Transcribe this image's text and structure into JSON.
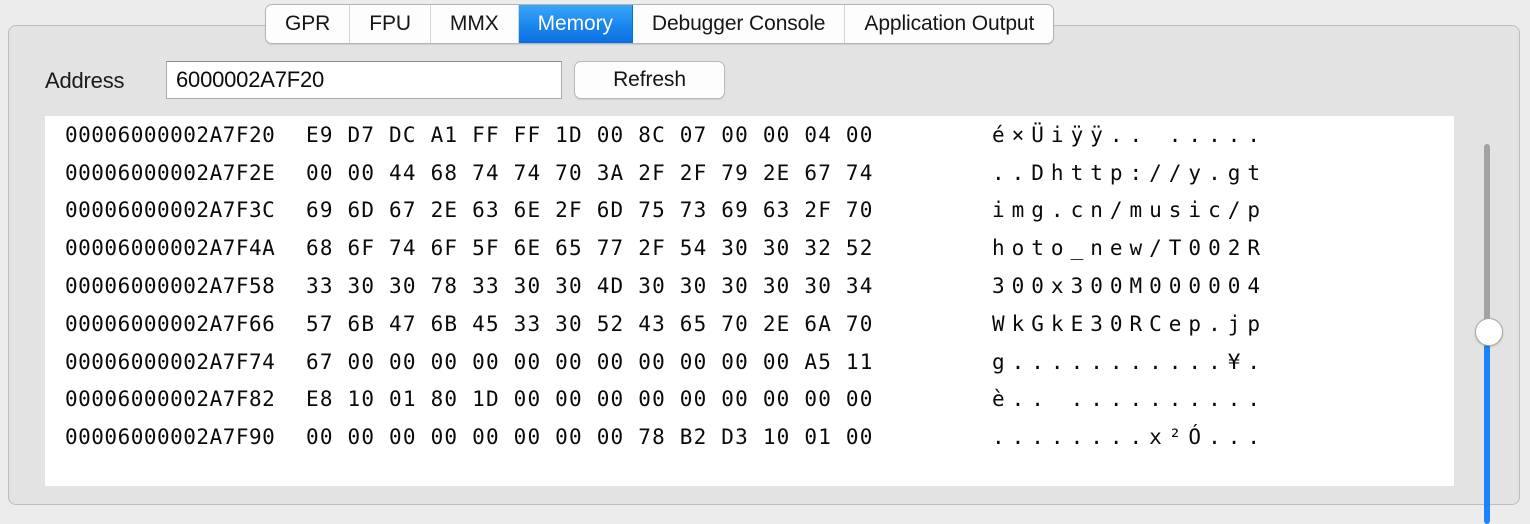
{
  "window": {
    "panel_title": ""
  },
  "tabs": [
    {
      "label": "GPR",
      "active": false
    },
    {
      "label": "FPU",
      "active": false
    },
    {
      "label": "MMX",
      "active": false
    },
    {
      "label": "Memory",
      "active": true
    },
    {
      "label": "Debugger Console",
      "active": false
    },
    {
      "label": "Application Output",
      "active": false
    }
  ],
  "toolbar": {
    "address_label": "Address",
    "address_value": "6000002A7F20",
    "address_placeholder": "",
    "refresh_label": "Refresh"
  },
  "hexview": {
    "bytes_per_row": 14,
    "rows": [
      {
        "address": "00006000002A7F20",
        "bytes": "E9 D7 DC A1 FF FF 1D 00 8C 07 00 00 04 00",
        "ascii": "é×Üiÿÿ.. ....."
      },
      {
        "address": "00006000002A7F2E",
        "bytes": "00 00 44 68 74 74 70 3A 2F 2F 79 2E 67 74",
        "ascii": "..Dhttp://y.gt"
      },
      {
        "address": "00006000002A7F3C",
        "bytes": "69 6D 67 2E 63 6E 2F 6D 75 73 69 63 2F 70",
        "ascii": "img.cn/music/p"
      },
      {
        "address": "00006000002A7F4A",
        "bytes": "68 6F 74 6F 5F 6E 65 77 2F 54 30 30 32 52",
        "ascii": "hoto_new/T002R"
      },
      {
        "address": "00006000002A7F58",
        "bytes": "33 30 30 78 33 30 30 4D 30 30 30 30 30 34",
        "ascii": "300x300M000004"
      },
      {
        "address": "00006000002A7F66",
        "bytes": "57 6B 47 6B 45 33 30 52 43 65 70 2E 6A 70",
        "ascii": "WkGkE30RCep.jp"
      },
      {
        "address": "00006000002A7F74",
        "bytes": "67 00 00 00 00 00 00 00 00 00 00 00 A5 11",
        "ascii": "g...........¥."
      },
      {
        "address": "00006000002A7F82",
        "bytes": "E8 10 01 80 1D 00 00 00 00 00 00 00 00 00",
        "ascii": "è.. .........."
      },
      {
        "address": "00006000002A7F90",
        "bytes": "00 00 00 00 00 00 00 00 78 B2 D3 10 01 00",
        "ascii": "........x²Ó..."
      }
    ]
  },
  "slider": {
    "name": "memory-scroll-slider",
    "value_percent": 46,
    "track_color": "#a3a3a3",
    "fill_color": "#1b84fb",
    "knob_color": "#ffffff"
  },
  "colors": {
    "accent": "#1d8cf0",
    "panel_bg": "#e3e3e3",
    "window_bg": "#ececec",
    "hex_bg": "#ffffff",
    "text": "#0a0a0a"
  }
}
